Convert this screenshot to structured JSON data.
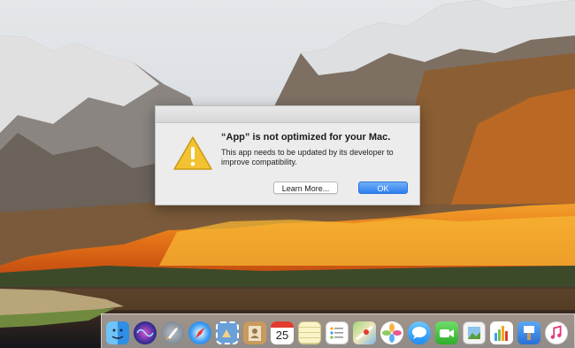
{
  "dialog": {
    "title": "“App” is not optimized for your Mac.",
    "message": "This app needs to be updated by its developer to improve compatibility.",
    "learn_more_label": "Learn More...",
    "ok_label": "OK",
    "icon": "warning-icon"
  },
  "dock": {
    "calendar_day": "25",
    "items": [
      {
        "name": "finder",
        "icon": "finder-icon"
      },
      {
        "name": "siri",
        "icon": "siri-icon"
      },
      {
        "name": "launchpad",
        "icon": "rocket-icon"
      },
      {
        "name": "safari",
        "icon": "compass-icon"
      },
      {
        "name": "mail",
        "icon": "stamp-icon"
      },
      {
        "name": "contacts",
        "icon": "contacts-book-icon"
      },
      {
        "name": "calendar",
        "icon": "calendar-icon"
      },
      {
        "name": "notes",
        "icon": "notes-icon"
      },
      {
        "name": "reminders",
        "icon": "list-icon"
      },
      {
        "name": "maps",
        "icon": "map-icon"
      },
      {
        "name": "photos",
        "icon": "flower-icon"
      },
      {
        "name": "messages",
        "icon": "speech-bubble-icon"
      },
      {
        "name": "facetime",
        "icon": "video-camera-icon"
      },
      {
        "name": "preview",
        "icon": "photo-frame-icon"
      },
      {
        "name": "numbers",
        "icon": "bar-chart-icon"
      },
      {
        "name": "keynote",
        "icon": "podium-icon"
      },
      {
        "name": "itunes",
        "icon": "music-note-icon"
      }
    ]
  },
  "colors": {
    "ok_button": "#2f7ff0",
    "warning_yellow": "#f2c230",
    "dialog_bg": "#ececec"
  }
}
